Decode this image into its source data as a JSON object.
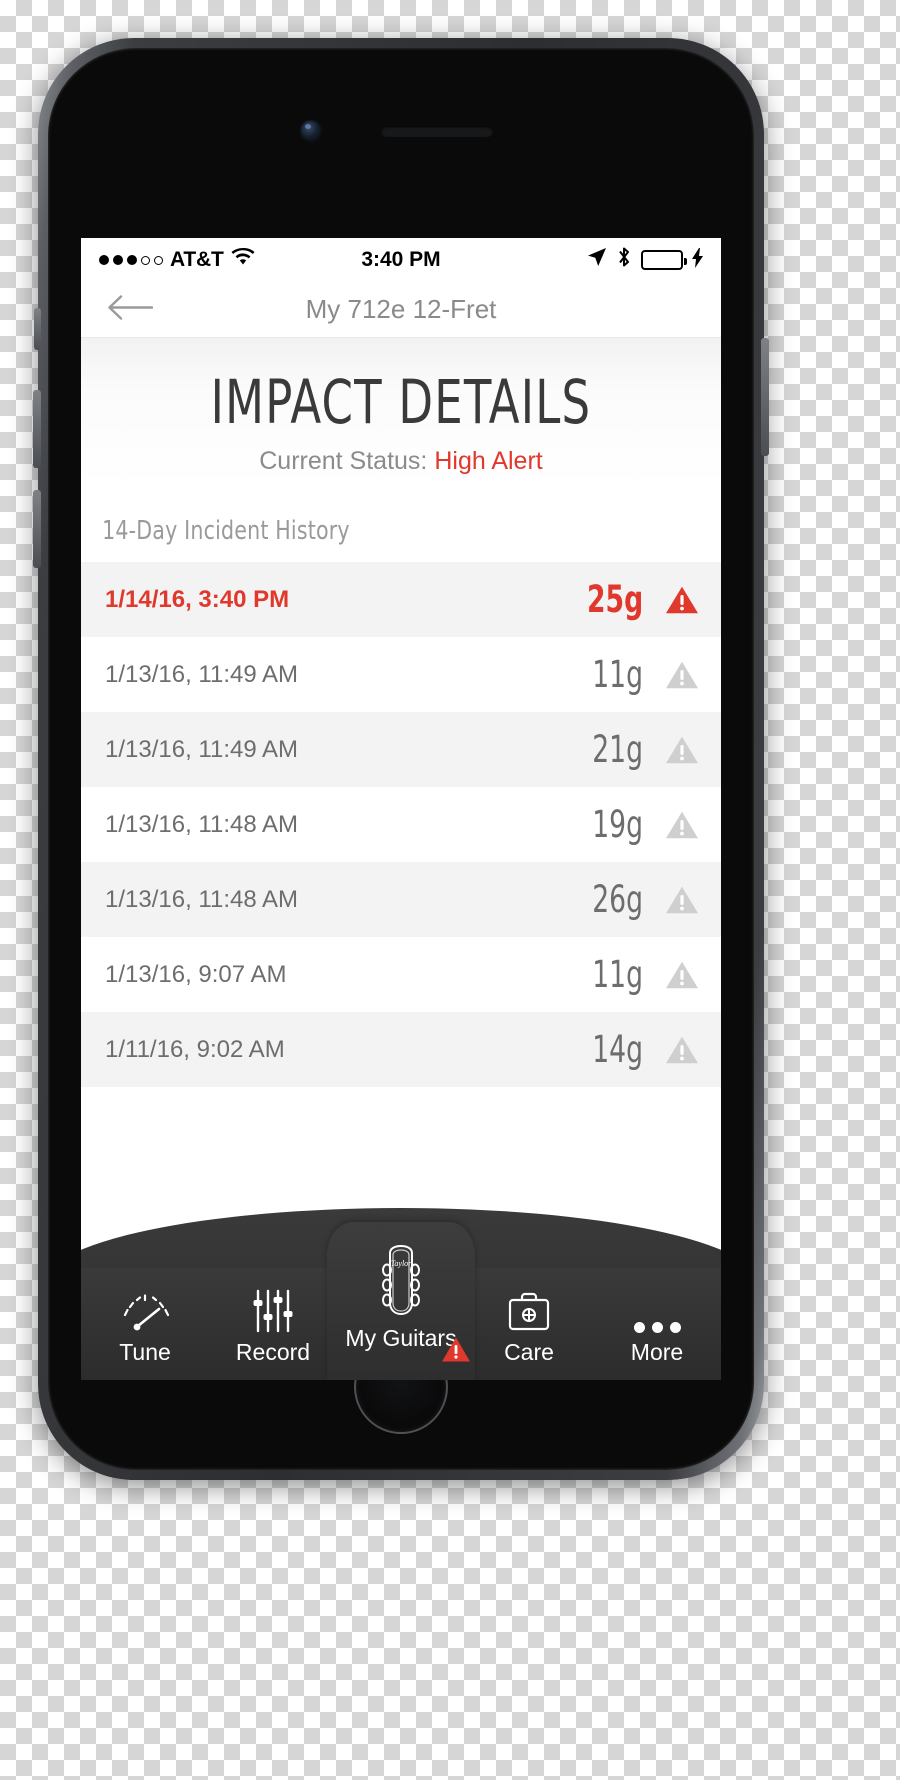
{
  "statusbar": {
    "signal_dots_filled": 3,
    "signal_dots_total": 5,
    "carrier": "AT&T",
    "wifi_icon": "wifi-icon",
    "time": "3:40 PM",
    "location_icon": "location-arrow-icon",
    "bluetooth_icon": "bluetooth-icon",
    "battery_icon": "battery-icon",
    "battery_color": "#4cd34c",
    "charging_icon": "lightning-bolt-icon"
  },
  "navbar": {
    "back_icon": "back-arrow-icon",
    "title": "My 712e 12-Fret"
  },
  "hero": {
    "title": "IMPACT DETAILS",
    "status_label": "Current Status:",
    "status_value": "High Alert",
    "status_color": "#e0382c"
  },
  "section": {
    "label": "14-Day Incident History"
  },
  "incidents": [
    {
      "date": "1/14/16, 3:40 PM",
      "value": "25g",
      "severity": "high",
      "icon": "warning-triangle-icon"
    },
    {
      "date": "1/13/16, 11:49 AM",
      "value": "11g",
      "severity": "normal",
      "icon": "warning-triangle-icon"
    },
    {
      "date": "1/13/16, 11:49 AM",
      "value": "21g",
      "severity": "normal",
      "icon": "warning-triangle-icon"
    },
    {
      "date": "1/13/16, 11:48 AM",
      "value": "19g",
      "severity": "normal",
      "icon": "warning-triangle-icon"
    },
    {
      "date": "1/13/16, 11:48 AM",
      "value": "26g",
      "severity": "normal",
      "icon": "warning-triangle-icon"
    },
    {
      "date": "1/13/16, 9:07 AM",
      "value": "11g",
      "severity": "normal",
      "icon": "warning-triangle-icon"
    },
    {
      "date": "1/11/16, 9:02 AM",
      "value": "14g",
      "severity": "normal",
      "icon": "warning-triangle-icon"
    }
  ],
  "tabbar": {
    "items": [
      {
        "label": "Tune",
        "icon": "tuner-gauge-icon"
      },
      {
        "label": "Record",
        "icon": "sliders-icon"
      },
      {
        "label": "My Guitars",
        "icon": "guitar-headstock-icon",
        "badge": "warning-triangle-icon",
        "active": true
      },
      {
        "label": "Care",
        "icon": "toolbox-icon"
      },
      {
        "label": "More",
        "icon": "ellipsis-icon"
      }
    ],
    "headstock_brand": "Taylor"
  }
}
